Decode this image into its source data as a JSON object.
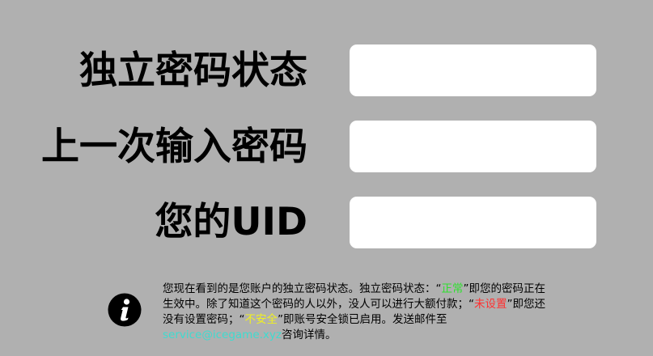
{
  "form": {
    "independent_password_status": {
      "label": "独立密码状态",
      "value": ""
    },
    "last_entered_password": {
      "label": "上一次输入密码",
      "value": ""
    },
    "your_uid": {
      "label": "您的UID",
      "value": ""
    }
  },
  "info": {
    "icon": "info-icon",
    "text_1": "您现在看到的是您账户的独立密码状态。独立密码状态：“",
    "status_normal": "正常",
    "text_2": "”即您的密码正在生效中。除了知道这个密码的人以外，没人可以进行大额付款；“",
    "status_unset": "未设置",
    "text_3": "”即您还没有设置密码；“",
    "status_unsafe": "不安全",
    "text_4": "”即账号安全锁已启用。发送邮件至",
    "email": "service@icegame.xyz",
    "text_5": "咨询详情。"
  },
  "colors": {
    "background": "#b0b0b0",
    "status_normal": "#2ee02e",
    "status_unset": "#ff3030",
    "status_unsafe": "#f0f020",
    "email_link": "#3ddcd0"
  }
}
